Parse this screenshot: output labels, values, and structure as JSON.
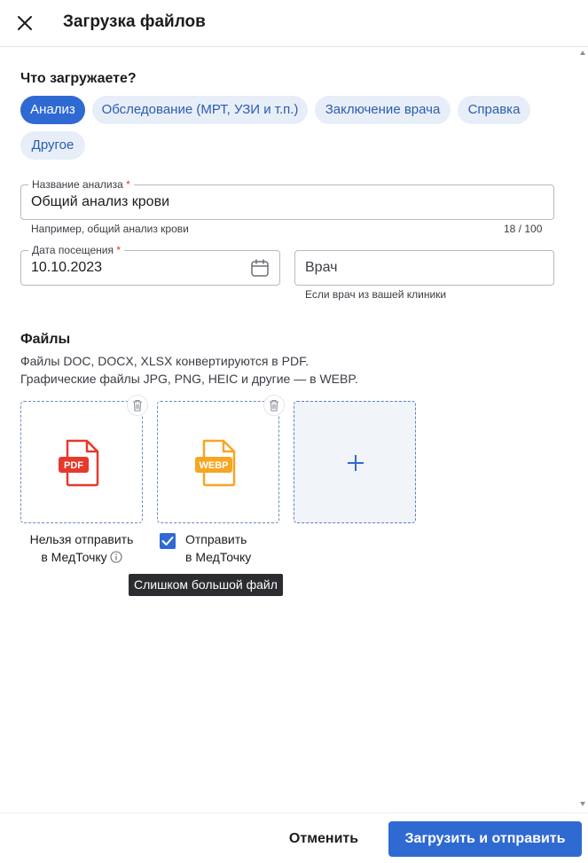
{
  "header": {
    "title": "Загрузка файлов",
    "close_icon": "close-icon"
  },
  "type_section": {
    "title": "Что загружаете?",
    "chips": [
      {
        "label": "Анализ",
        "selected": true
      },
      {
        "label": "Обследование (МРТ, УЗИ и т.п.)",
        "selected": false
      },
      {
        "label": "Заключение врача",
        "selected": false
      },
      {
        "label": "Справка",
        "selected": false
      },
      {
        "label": "Другое",
        "selected": false
      }
    ]
  },
  "form": {
    "name": {
      "label": "Название анализа",
      "required_mark": "*",
      "value": "Общий анализ крови",
      "helper": "Например, общий анализ крови",
      "counter": "18 / 100"
    },
    "date": {
      "label": "Дата посещения",
      "required_mark": "*",
      "value": "10.10.2023",
      "icon": "calendar-icon"
    },
    "doctor": {
      "placeholder": "Врач",
      "helper": "Если врач из вашей клиники"
    }
  },
  "files_section": {
    "title": "Файлы",
    "desc_line1": "Файлы DOC, DOCX, XLSX конвертируются в PDF.",
    "desc_line2": "Графические файлы JPG, PNG, HEIC и другие — в WEBP.",
    "files": [
      {
        "type_label": "PDF",
        "color": "#e53a2b",
        "caption_line1": "Нельзя отправить",
        "caption_line2": "в МедТочку",
        "sendable": false
      },
      {
        "type_label": "WEBP",
        "color": "#f5a623",
        "caption_line1": "Отправить",
        "caption_line2": "в МедТочку",
        "checked": true
      }
    ],
    "add_icon": "plus-icon",
    "tooltip": "Слишком большой файл"
  },
  "footer": {
    "cancel_label": "Отменить",
    "submit_label": "Загрузить и отправить"
  },
  "colors": {
    "accent": "#2f6ad3",
    "chip_bg": "#e8eef8",
    "required": "#e0352b"
  }
}
